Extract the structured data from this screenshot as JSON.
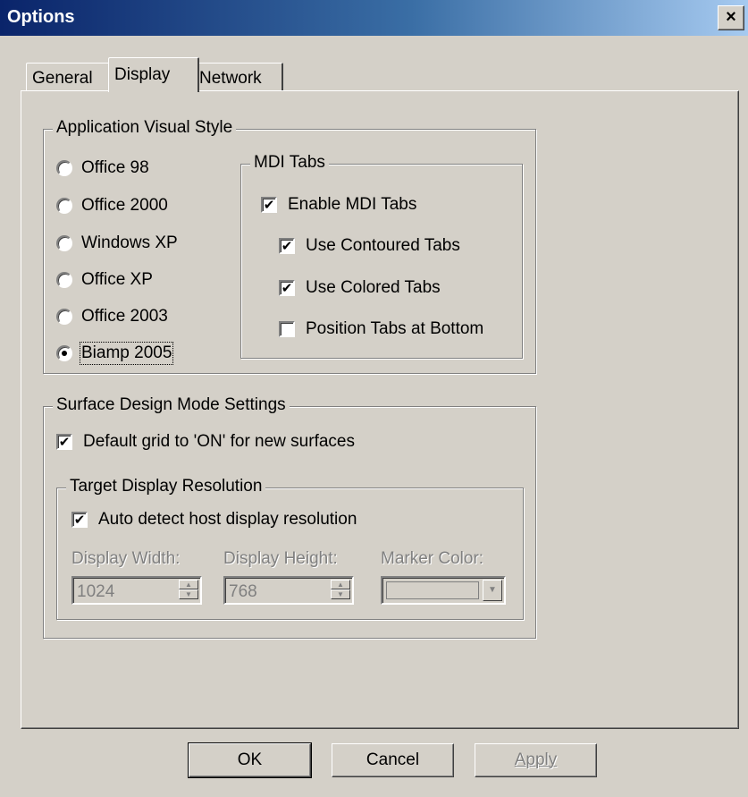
{
  "window": {
    "title": "Options",
    "close_glyph": "×"
  },
  "tabs": [
    {
      "label": "General"
    },
    {
      "label": "Display",
      "active": true
    },
    {
      "label": "Network"
    }
  ],
  "visual_style": {
    "legend": "Application Visual Style",
    "options": [
      "Office 98",
      "Office 2000",
      "Windows XP",
      "Office XP",
      "Office 2003",
      "Biamp 2005"
    ],
    "selected": "Biamp 2005"
  },
  "mdi_tabs": {
    "legend": "MDI Tabs",
    "enable": {
      "label": "Enable MDI Tabs",
      "checked": true
    },
    "contoured": {
      "label": "Use Contoured Tabs",
      "checked": true
    },
    "colored": {
      "label": "Use Colored Tabs",
      "checked": true
    },
    "bottom": {
      "label": "Position Tabs at Bottom",
      "checked": false
    }
  },
  "surface": {
    "legend": "Surface Design Mode Settings",
    "default_grid": {
      "label": "Default grid to 'ON' for new surfaces",
      "checked": true
    }
  },
  "resolution": {
    "legend": "Target Display Resolution",
    "auto_detect": {
      "label": "Auto detect host display resolution",
      "checked": true
    },
    "width_label": "Display Width:",
    "width_value": "1024",
    "height_label": "Display Height:",
    "height_value": "768",
    "marker_label": "Marker Color:"
  },
  "buttons": {
    "ok": "OK",
    "cancel": "Cancel",
    "apply": "Apply"
  },
  "check_glyph": "✔"
}
